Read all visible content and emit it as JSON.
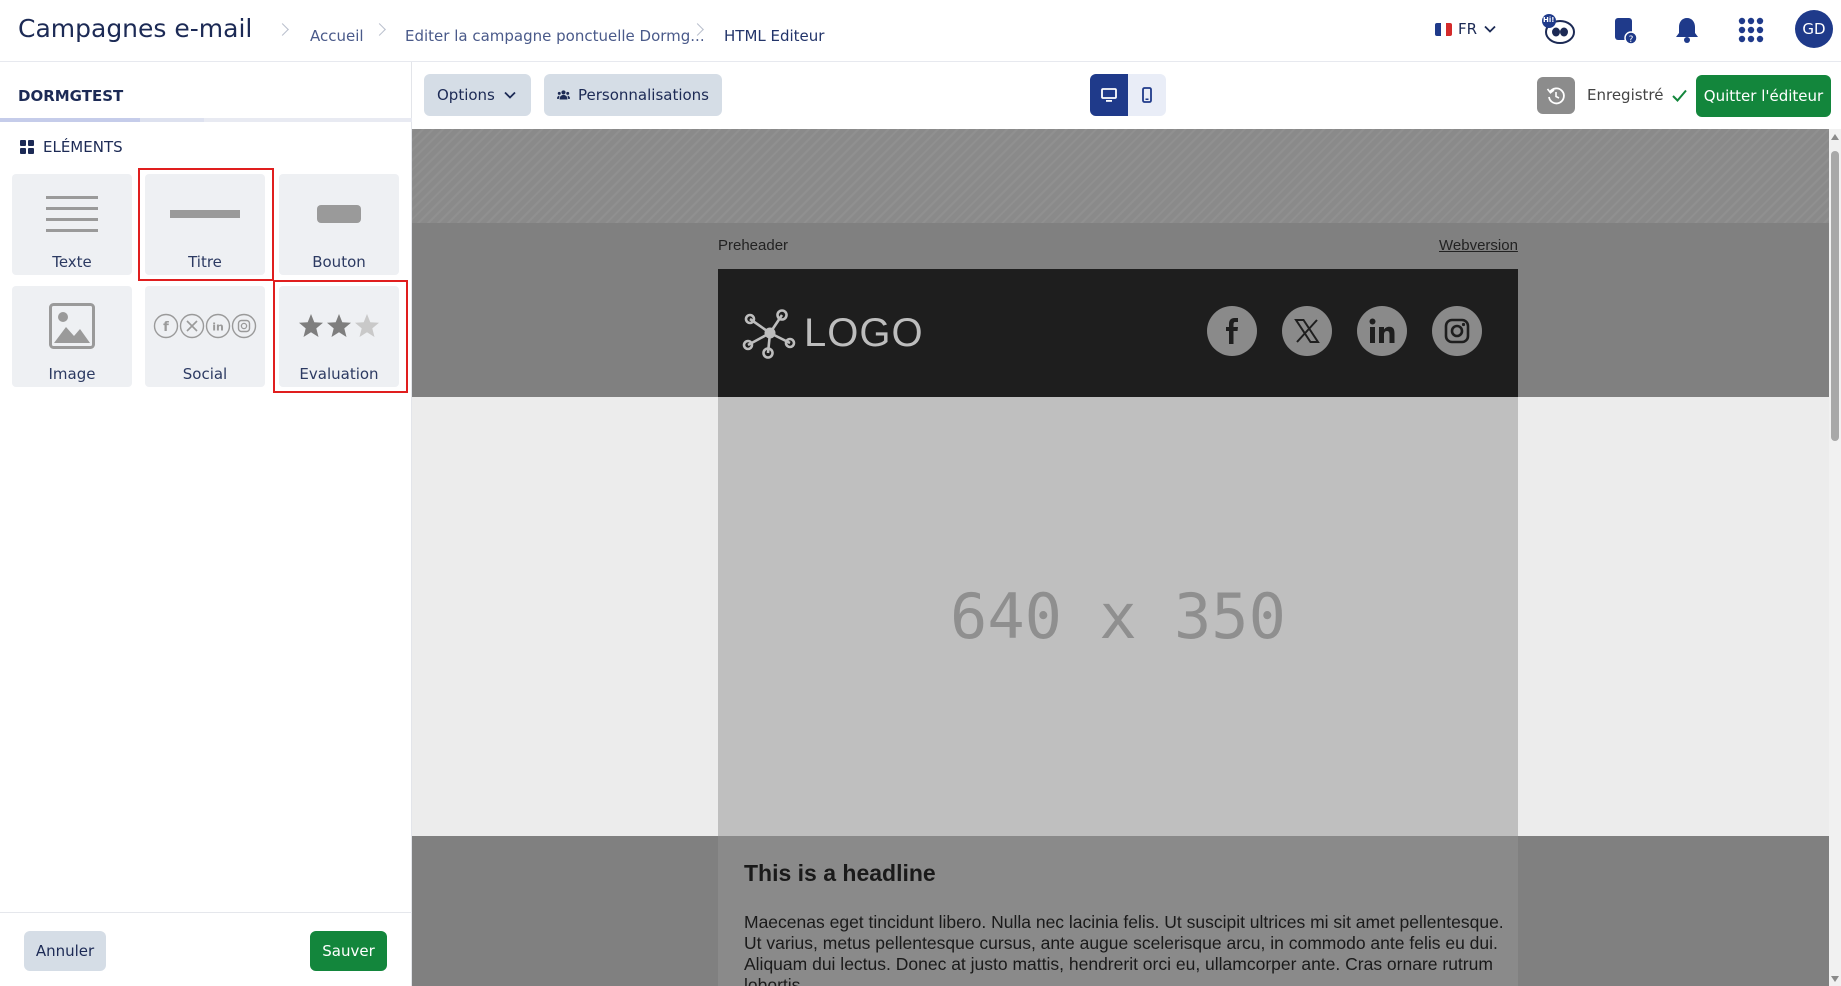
{
  "header": {
    "app_title": "Campagnes e-mail",
    "breadcrumbs": [
      "Accueil",
      "Editer la campagne ponctuelle Dormg...",
      "HTML Editeur"
    ],
    "language": "FR",
    "avatar_initials": "GD",
    "help_badge": "Hi!",
    "icons": [
      "flag-fr-icon",
      "chevron-down-icon",
      "assistant-icon",
      "help-doc-icon",
      "bell-icon",
      "apps-grid-icon"
    ]
  },
  "sidebar": {
    "title": "DORMGTEST",
    "section_label": "ELÉMENTS",
    "elements": [
      {
        "label": "Texte",
        "icon": "text-lines-icon"
      },
      {
        "label": "Titre",
        "icon": "title-bar-icon",
        "highlighted": true
      },
      {
        "label": "Bouton",
        "icon": "button-shape-icon"
      },
      {
        "label": "Image",
        "icon": "image-icon"
      },
      {
        "label": "Social",
        "icon": "social-icons-icon"
      },
      {
        "label": "Evaluation",
        "icon": "stars-rating-icon",
        "highlighted": true
      }
    ],
    "cancel_label": "Annuler",
    "save_label": "Sauver"
  },
  "toolbar": {
    "options_label": "Options",
    "personalization_label": "Personnalisations",
    "device_selected": "desktop",
    "saved_label": "Enregistré",
    "quit_label": "Quitter l'éditeur"
  },
  "email": {
    "preheader": "Preheader",
    "webversion": "Webversion",
    "logo_text": "LOGO",
    "social_networks": [
      "facebook",
      "x",
      "linkedin",
      "instagram"
    ],
    "hero_placeholder": "640 x 350",
    "headline": "This is a headline",
    "body": "Maecenas eget tincidunt libero. Nulla nec lacinia felis. Ut suscipit ultrices mi sit amet pellentesque. Ut varius, metus pellentesque cursus, ante augue scelerisque arcu, in commodo ante felis eu dui. Aliquam dui lectus. Donec at justo mattis, hendrerit orci eu, ullamcorper ante. Cras ornare rutrum lobortis."
  },
  "colors": {
    "brand_navy": "#1f3a8a",
    "action_green": "#13863c",
    "highlight_red": "#e01e1e"
  }
}
